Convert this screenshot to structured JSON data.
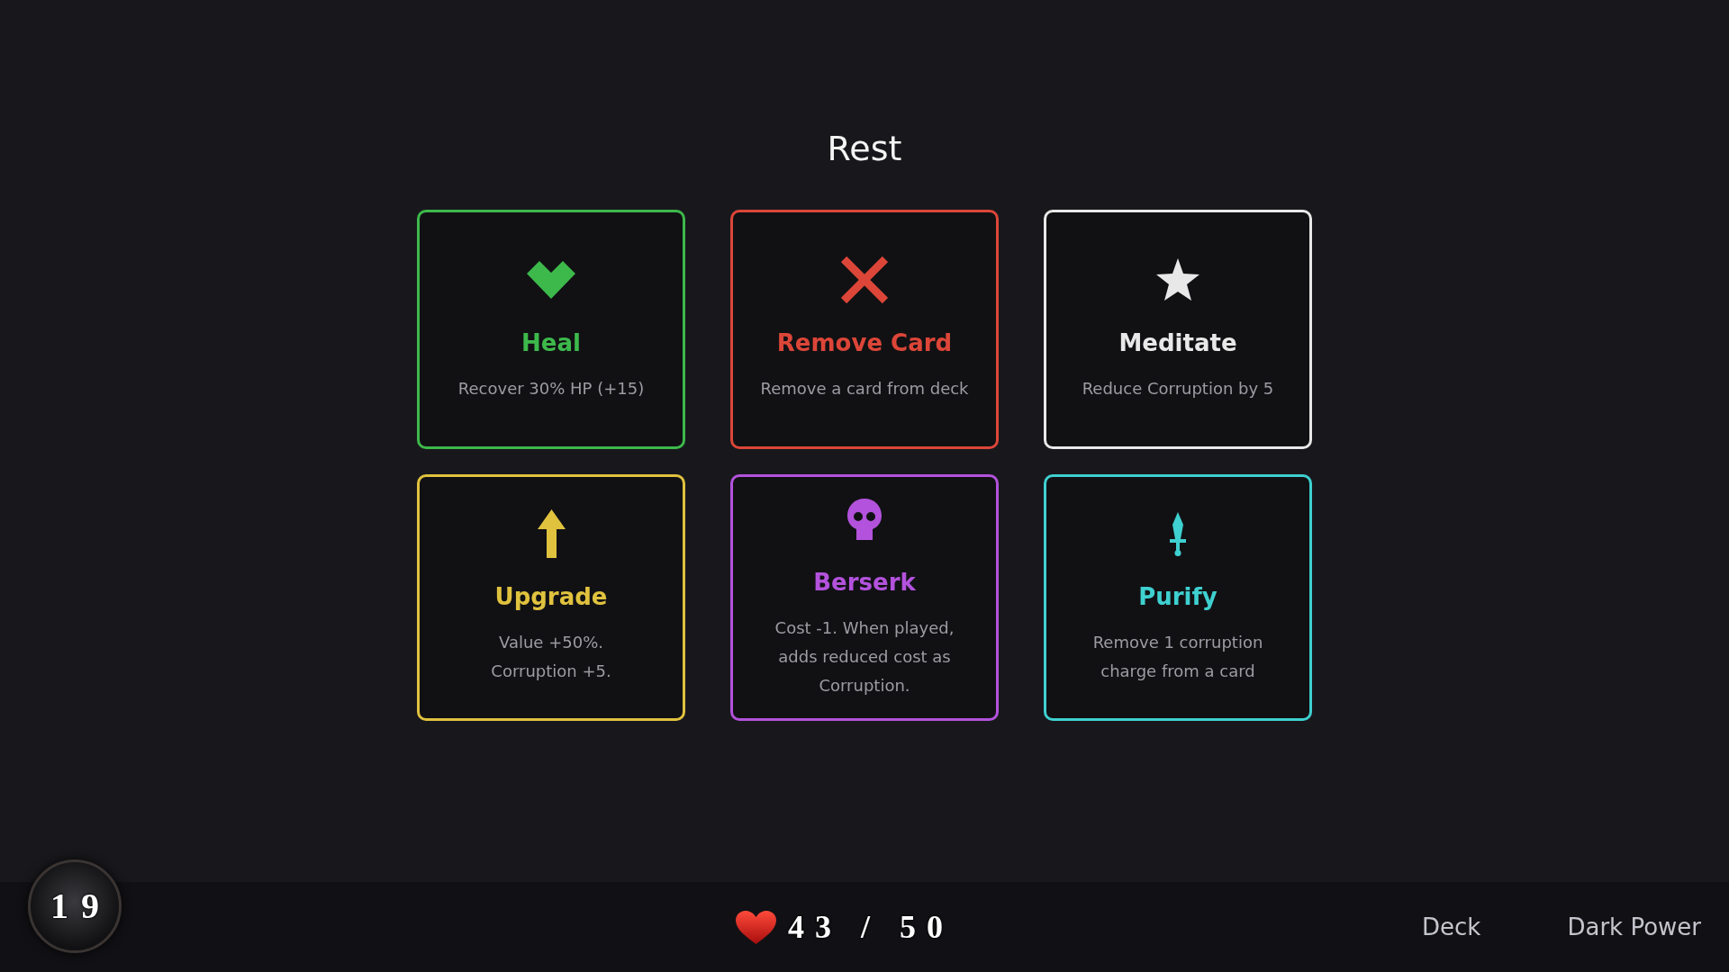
{
  "title": "Rest",
  "options": [
    {
      "kind": "heart",
      "title": "Heal",
      "description": "Recover 30% HP (+15)",
      "color": "#3db94b"
    },
    {
      "kind": "cross",
      "title": "Remove Card",
      "description": "Remove a card from deck",
      "color": "#dc4638"
    },
    {
      "kind": "star",
      "title": "Meditate",
      "description": "Reduce Corruption by 5",
      "color": "#e8e8e8"
    },
    {
      "kind": "arrow",
      "title": "Upgrade",
      "description": "Value +50%.\nCorruption +5.",
      "color": "#e0c23e"
    },
    {
      "kind": "skull",
      "title": "Berserk",
      "description": "Cost -1. When played,\nadds reduced cost as\nCorruption.",
      "color": "#b352dc"
    },
    {
      "kind": "sword",
      "title": "Purify",
      "description": "Remove 1 corruption\ncharge from a card",
      "color": "#3fd0d0"
    }
  ],
  "bottom_bar": {
    "counter": "19",
    "hp": "43 / 50",
    "links": [
      "Deck",
      "Dark Power"
    ]
  }
}
